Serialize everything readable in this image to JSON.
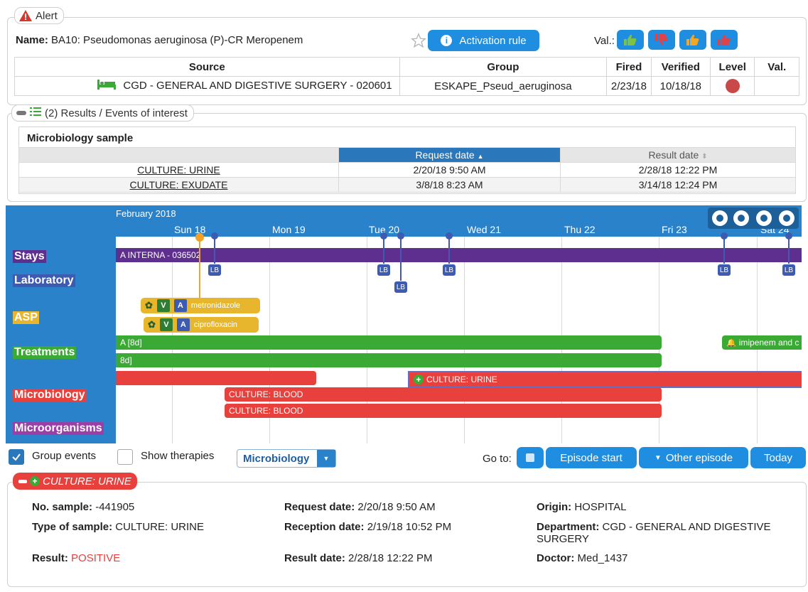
{
  "alert": {
    "legend": "Alert",
    "name_label": "Name:",
    "name_value": "BA10: Pseudomonas aeruginosa (P)-CR  Meropenem",
    "activation_rule": "Activation rule",
    "val_label": "Val.:",
    "table": {
      "headers": [
        "Source",
        "Group",
        "Fired",
        "Verified",
        "Level",
        "Val."
      ],
      "row": {
        "source": "CGD - GENERAL AND DIGESTIVE SURGERY - 020601",
        "group": "ESKAPE_Pseud_aeruginosa",
        "fired": "2/23/18",
        "verified": "10/18/18"
      }
    },
    "colors": {
      "accent": "#1f8de0",
      "level": "#c94848"
    }
  },
  "results": {
    "legend": "(2) Results / Events of interest",
    "section_title": "Microbiology sample",
    "col_request": "Request date",
    "col_result": "Result date",
    "rows": [
      {
        "name": "CULTURE: URINE",
        "request": "2/20/18 9:50 AM",
        "result": "2/28/18 12:22 PM"
      },
      {
        "name": "CULTURE: EXUDATE",
        "request": "3/8/18 8:23 AM",
        "result": "3/14/18 12:24 PM"
      }
    ]
  },
  "timeline": {
    "month": "February 2018",
    "days": [
      "Sun 18",
      "Mon 19",
      "Tue 20",
      "Wed 21",
      "Thu 22",
      "Fri 23",
      "Sat 24"
    ],
    "categories": {
      "stays": "Stays",
      "laboratory": "Laboratory",
      "asp": "ASP",
      "treatments": "Treatments",
      "microbiology": "Microbiology",
      "microorganisms": "Microorganisms"
    },
    "stay_bar": "A INTERNA - 036502",
    "lb": "LB",
    "asp": {
      "v": "V",
      "a": "A",
      "drug1": "metronidazole",
      "drug2": "ciprofloxacin"
    },
    "treatments": {
      "bar1": "A [8d]",
      "bar2": "8d]",
      "bar3": "imipenem and c"
    },
    "micro": {
      "urine": "CULTURE: URINE",
      "blood1": "CULTURE: BLOOD",
      "blood2": "CULTURE: BLOOD"
    },
    "colors": {
      "header": "#2a82cb",
      "stay": "#5e2f8f",
      "treatment": "#3aaa35",
      "micro": "#e8403c",
      "asp": "#e7b62c",
      "lab": "#3d5bb0",
      "now": "#f4a224"
    }
  },
  "controls": {
    "group_events": "Group events",
    "show_therapies": "Show therapies",
    "select_value": "Microbiology",
    "goto": "Go to:",
    "episode_start": "Episode start",
    "other_episode": "Other episode",
    "today": "Today"
  },
  "detail": {
    "legend": "CULTURE: URINE",
    "no_sample_label": "No. sample:",
    "no_sample_value": "-441905",
    "type_label": "Type of sample:",
    "type_value": "CULTURE: URINE",
    "result_label": "Result:",
    "result_value": "POSITIVE",
    "request_label": "Request date:",
    "request_value": "2/20/18 9:50 AM",
    "reception_label": "Reception date:",
    "reception_value": "2/19/18 10:52 PM",
    "result_date_label": "Result date:",
    "result_date_value": "2/28/18 12:22 PM",
    "origin_label": "Origin:",
    "origin_value": "HOSPITAL",
    "department_label": "Department:",
    "department_value": "CGD - GENERAL AND DIGESTIVE SURGERY",
    "doctor_label": "Doctor:",
    "doctor_value": "Med_1437"
  }
}
